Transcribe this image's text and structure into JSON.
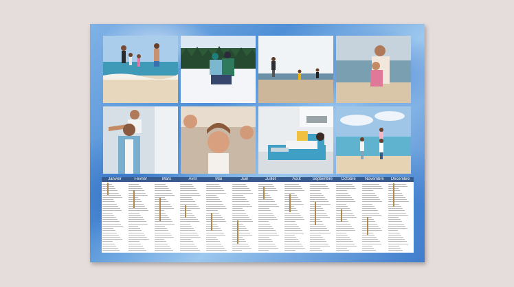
{
  "photos": [
    {
      "name": "photo-family-beach-walk"
    },
    {
      "name": "photo-family-snow-hug"
    },
    {
      "name": "photo-family-running-beach"
    },
    {
      "name": "photo-mother-child-beach"
    },
    {
      "name": "photo-father-daughter-piggyback"
    },
    {
      "name": "photo-girl-airplane"
    },
    {
      "name": "photo-woman-sofa"
    },
    {
      "name": "photo-family-shore-lift"
    }
  ],
  "calendar": {
    "months": [
      "Janvier",
      "Février",
      "Mars",
      "Avril",
      "Mai",
      "Juin",
      "Juillet",
      "Août",
      "Septembre",
      "Octobre",
      "Novembre",
      "Décembre"
    ]
  },
  "colors": {
    "month_header": "#365b8c",
    "poster_blue": "#4f8fd6",
    "background": "#e5dcdc"
  }
}
